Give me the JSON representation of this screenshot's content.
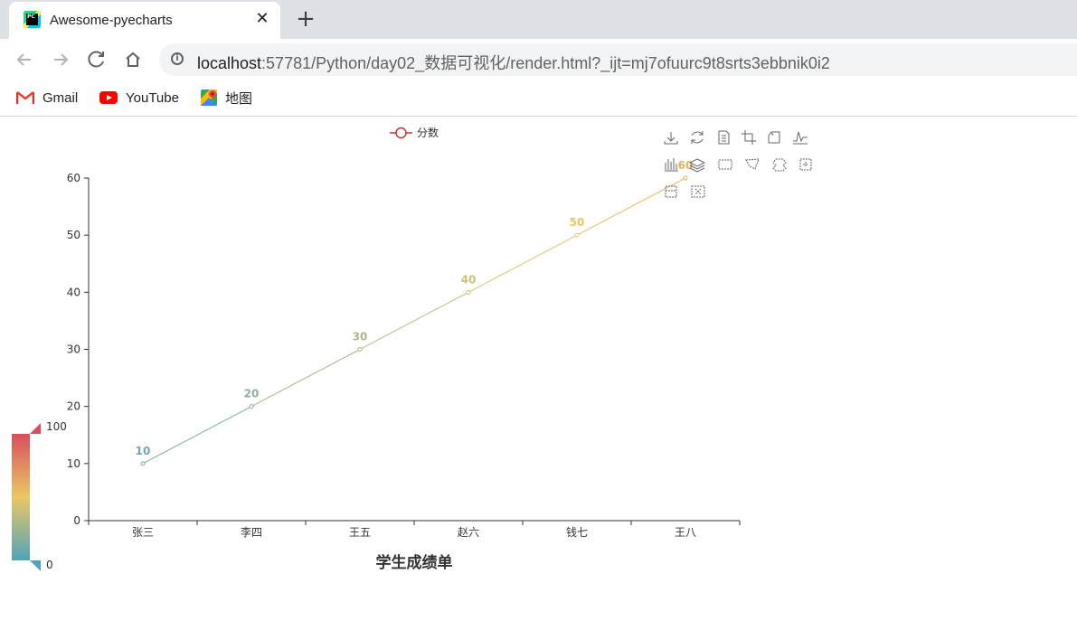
{
  "browser": {
    "tab_title": "Awesome-pyecharts",
    "tab_close": "✕",
    "new_tab": "+",
    "url_host": "localhost",
    "url_rest": ":57781/Python/day02_数据可视化/render.html?_ijt=mj7ofuurc9t8srts3ebbnik0i2",
    "bookmarks": [
      {
        "label": "Gmail",
        "icon": "gmail-icon"
      },
      {
        "label": "YouTube",
        "icon": "youtube-icon"
      },
      {
        "label": "地图",
        "icon": "maps-icon"
      }
    ]
  },
  "chart_data": {
    "type": "line",
    "title": "学生成绩单",
    "categories": [
      "张三",
      "李四",
      "王五",
      "赵六",
      "钱七",
      "王八"
    ],
    "series": [
      {
        "name": "分数",
        "values": [
          10,
          20,
          30,
          40,
          50,
          60
        ]
      }
    ],
    "ylim": [
      0,
      60
    ],
    "yticks": [
      "0",
      "10",
      "20",
      "30",
      "40",
      "50",
      "60"
    ],
    "grid": false,
    "legend": "top-center",
    "visual_map": {
      "min_label": "0",
      "max_label": "100",
      "min": 0,
      "max": 100,
      "colors": [
        "#50a3ba",
        "#eac763",
        "#d94e5d"
      ]
    },
    "series_color": "#c23531"
  },
  "toolbox_icons": [
    "download-icon",
    "refresh-icon",
    "data-view-icon",
    "zoom-icon",
    "zoom-reset-icon",
    "line-icon",
    "bar-icon",
    "stack-icon",
    "rect-select-icon",
    "polygon-select-icon",
    "keep-select-icon",
    "clear-select-icon",
    "brush-icon",
    "clear-brush-icon"
  ]
}
